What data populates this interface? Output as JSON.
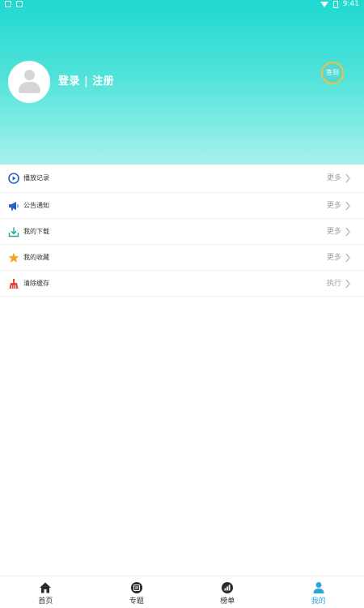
{
  "status_bar": {
    "time": "9:41"
  },
  "profile": {
    "login_label": "登录 | 注册",
    "signin_label": "签到"
  },
  "menu": {
    "items": [
      {
        "label": "播放记录",
        "action": "更多",
        "icon": "play-circle-icon"
      },
      {
        "label": "公告通知",
        "action": "更多",
        "icon": "megaphone-icon"
      },
      {
        "label": "我的下载",
        "action": "更多",
        "icon": "download-icon"
      },
      {
        "label": "我的收藏",
        "action": "更多",
        "icon": "star-icon"
      },
      {
        "label": "清除缓存",
        "action": "执行",
        "icon": "broom-icon"
      }
    ]
  },
  "bottom_nav": {
    "items": [
      {
        "label": "首页",
        "icon": "home-icon"
      },
      {
        "label": "专题",
        "icon": "topic-icon"
      },
      {
        "label": "榜单",
        "icon": "chart-icon"
      },
      {
        "label": "我的",
        "icon": "user-icon"
      }
    ],
    "active_index": 3
  },
  "colors": {
    "header_top": "#1ed9d0",
    "header_bottom": "#a6f1ed",
    "active_tab": "#29a8e0",
    "signin_ring": "#f0c23a"
  }
}
